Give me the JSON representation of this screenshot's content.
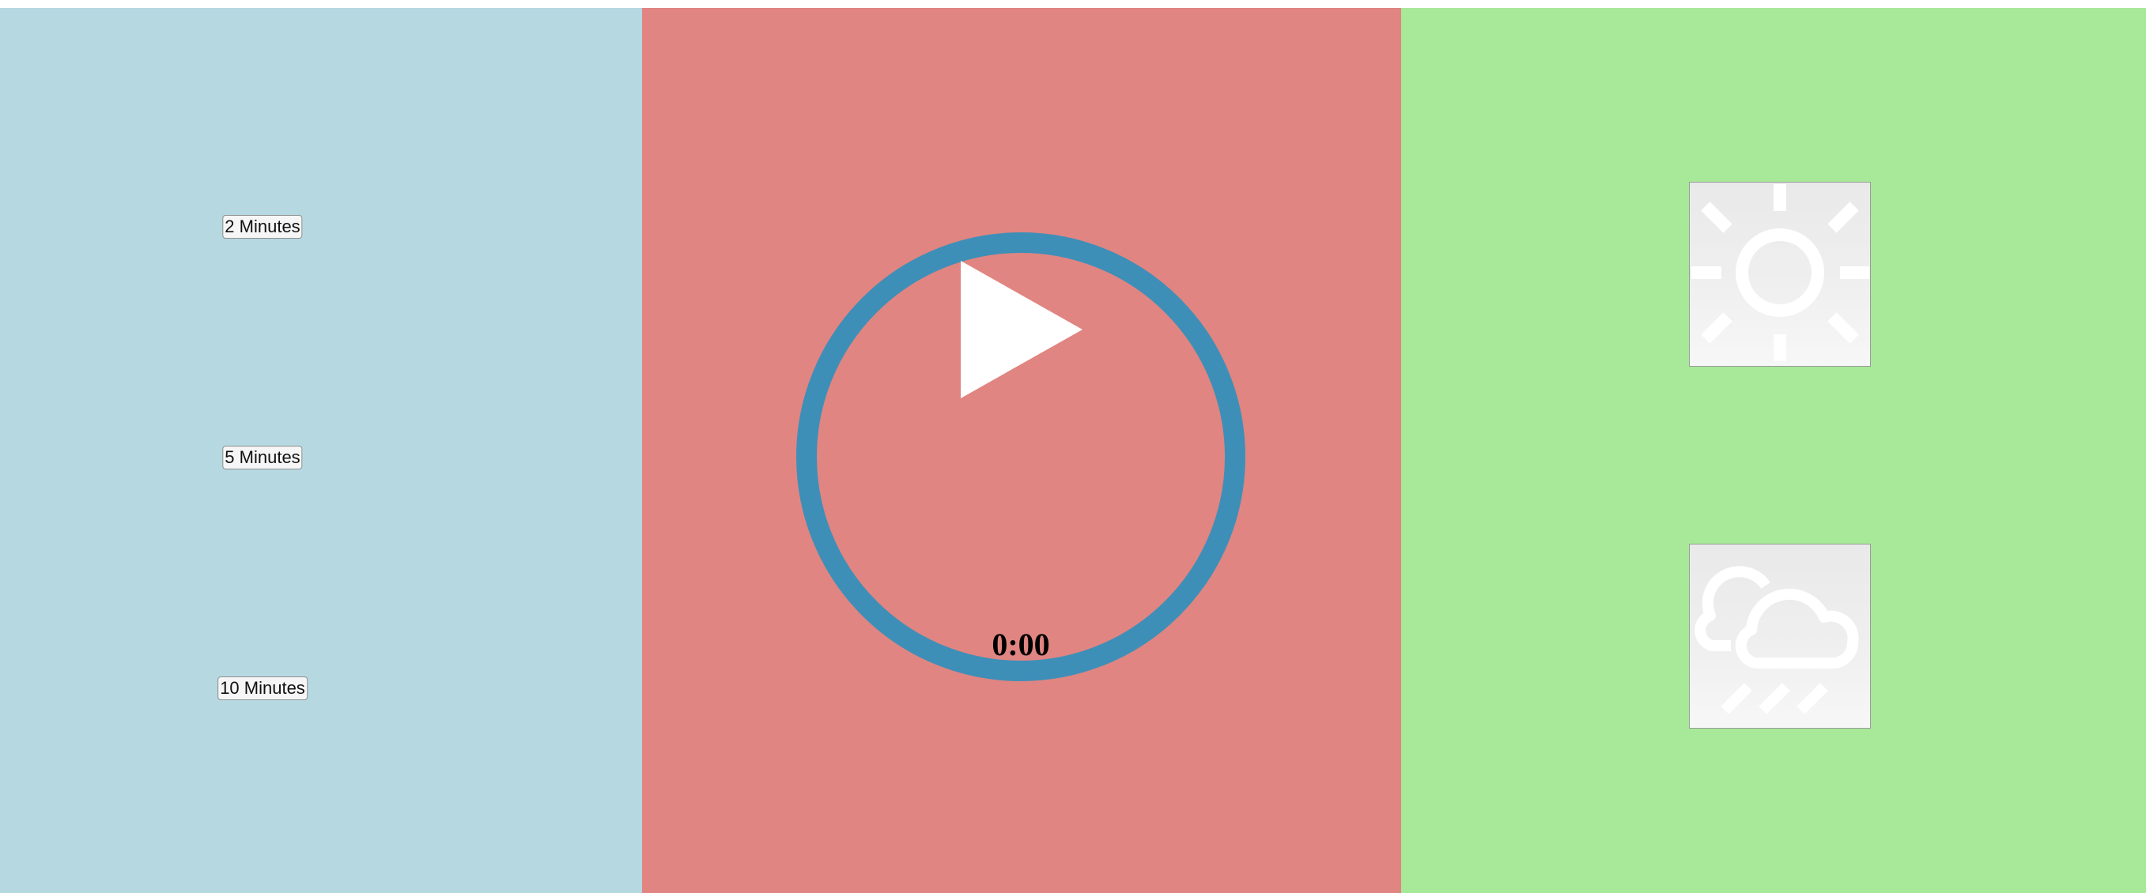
{
  "durations": {
    "items": [
      {
        "label": "2 Minutes"
      },
      {
        "label": "5 Minutes"
      },
      {
        "label": "10 Minutes"
      }
    ]
  },
  "timer": {
    "time": "0:00",
    "play_icon": "play-icon"
  },
  "weather": {
    "options": [
      {
        "icon": "sun-icon"
      },
      {
        "icon": "rain-cloud-icon"
      }
    ]
  },
  "colors": {
    "left_panel": "#b6d8e1",
    "center_panel": "#e08581",
    "right_panel": "#a7e998",
    "ring": "#3d8fb8",
    "icon": "#ffffff"
  }
}
